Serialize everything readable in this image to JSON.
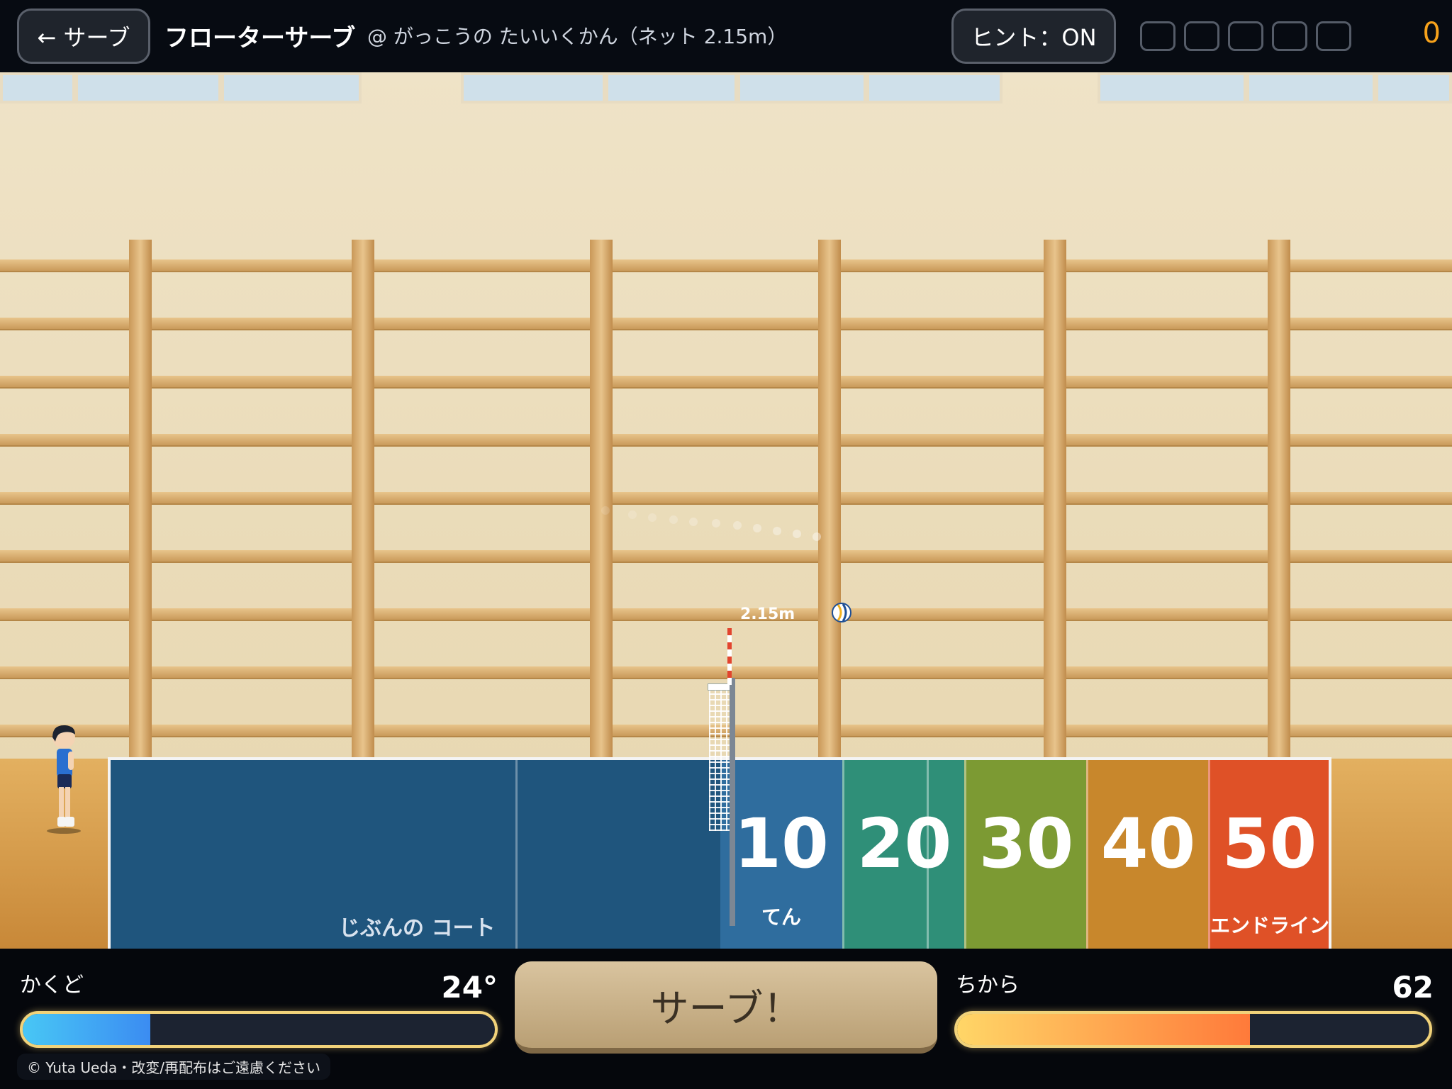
{
  "topbar": {
    "back_label": "← サーブ",
    "title": "フローターサーブ",
    "subtitle": "@ がっこうの たいいくかん（ネット 2.15m）",
    "hint_label": "ヒント：ON",
    "slots_filled": 0,
    "score": "0"
  },
  "court": {
    "own_label": "じぶんの コート",
    "net_height_label": "2.15m",
    "zones": [
      {
        "points": "10",
        "sub": "てん",
        "color": "#2f6d9e"
      },
      {
        "points": "20",
        "sub": "",
        "color": "#2f8f78"
      },
      {
        "points": "30",
        "sub": "",
        "color": "#7c9a33"
      },
      {
        "points": "40",
        "sub": "",
        "color": "#c8872c"
      },
      {
        "points": "50",
        "sub": "エンドライン",
        "color": "#df5127"
      }
    ],
    "own_color": "#1f557d"
  },
  "controls": {
    "angle_label": "かくど",
    "angle_value": "24°",
    "angle_fraction": 0.27,
    "serve_label": "サーブ！",
    "power_label": "ちから",
    "power_value": "62",
    "power_fraction": 0.62
  },
  "footer": {
    "copyright": "© Yuta Ueda・改変/再配布はご遠慮ください"
  }
}
